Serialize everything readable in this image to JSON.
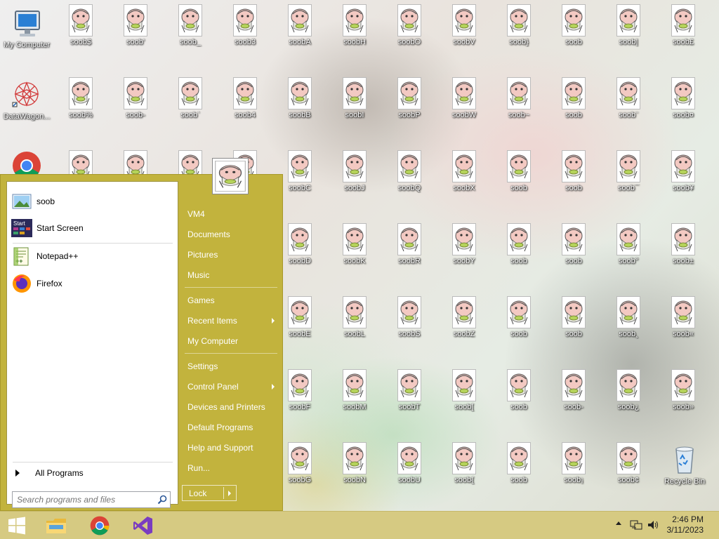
{
  "desktop": {
    "my_computer": "My Computer",
    "datawagon": "DataWagon...",
    "chrome": "",
    "recycle_bin": "Recycle Bin",
    "soob_columns": [
      [
        "soob$",
        "soob%",
        "",
        "",
        "",
        "",
        ""
      ],
      [
        "soob'",
        "soob-",
        "",
        "",
        "",
        "",
        ""
      ],
      [
        "soob_",
        "soob`",
        "",
        "",
        "",
        "",
        ""
      ],
      [
        "soob3",
        "soob4",
        "",
        "",
        "",
        "",
        ""
      ],
      [
        "soobA",
        "soobB",
        "soobC",
        "soobD",
        "soobE",
        "soobF",
        "soobG"
      ],
      [
        "soobH",
        "soobI",
        "soobJ",
        "soobK",
        "soobL",
        "soobM",
        "soobN"
      ],
      [
        "soobO",
        "soobP",
        "soobQ",
        "soobR",
        "soobS",
        "soobT",
        "soobU"
      ],
      [
        "soobV",
        "soobW",
        "soobX",
        "soobY",
        "soobZ",
        "soob[",
        "soob{"
      ],
      [
        "soob}",
        "soob~",
        "soob",
        "soob",
        "soob",
        "soob",
        "soob"
      ],
      [
        "soob",
        "soob",
        "soob",
        "soob",
        "soob",
        "soob-",
        "soob¡"
      ],
      [
        "soob|",
        "soob¨",
        "soob¯",
        "soob°",
        "soob¸",
        "soob¿",
        "soob¢"
      ],
      [
        "soob£",
        "soob¤",
        "soob¥",
        "soob±",
        "soob«",
        "soob»",
        ""
      ]
    ]
  },
  "start_menu": {
    "pinned": [
      {
        "label": "soob",
        "icon": "picture-icon"
      },
      {
        "label": "Start Screen",
        "icon": "start-screen-icon"
      }
    ],
    "recent": [
      {
        "label": "Notepad++",
        "icon": "notepadpp-icon"
      },
      {
        "label": "Firefox",
        "icon": "firefox-icon"
      }
    ],
    "all_programs": "All Programs",
    "search_placeholder": "Search programs and files",
    "right": [
      {
        "label": "VM4"
      },
      {
        "label": "Documents"
      },
      {
        "label": "Pictures"
      },
      {
        "label": "Music"
      },
      {
        "label": "Games"
      },
      {
        "label": "Recent Items"
      },
      {
        "label": "My Computer"
      },
      {
        "label": "Settings"
      },
      {
        "label": "Control Panel"
      },
      {
        "label": "Devices and Printers"
      },
      {
        "label": "Default Programs"
      },
      {
        "label": "Help and Support"
      },
      {
        "label": "Run..."
      }
    ],
    "lock_label": "Lock"
  },
  "taskbar": {
    "time": "2:46 PM",
    "date": "3/11/2023",
    "pinned_icons": [
      "start-icon",
      "file-explorer-icon",
      "chrome-icon",
      "visual-studio-icon"
    ]
  },
  "colors": {
    "start_menu": "#c2b33d",
    "taskbar": "#d6ca82"
  }
}
